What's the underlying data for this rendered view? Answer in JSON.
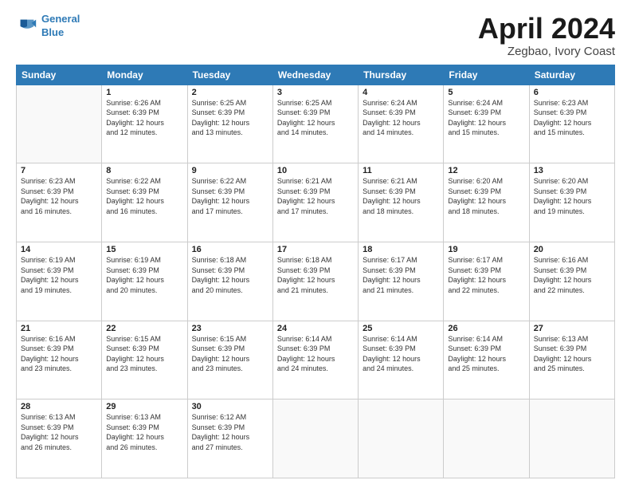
{
  "logo": {
    "line1": "General",
    "line2": "Blue"
  },
  "title": "April 2024",
  "subtitle": "Zegbao, Ivory Coast",
  "headers": [
    "Sunday",
    "Monday",
    "Tuesday",
    "Wednesday",
    "Thursday",
    "Friday",
    "Saturday"
  ],
  "weeks": [
    [
      {
        "day": "",
        "info": ""
      },
      {
        "day": "1",
        "info": "Sunrise: 6:26 AM\nSunset: 6:39 PM\nDaylight: 12 hours\nand 12 minutes."
      },
      {
        "day": "2",
        "info": "Sunrise: 6:25 AM\nSunset: 6:39 PM\nDaylight: 12 hours\nand 13 minutes."
      },
      {
        "day": "3",
        "info": "Sunrise: 6:25 AM\nSunset: 6:39 PM\nDaylight: 12 hours\nand 14 minutes."
      },
      {
        "day": "4",
        "info": "Sunrise: 6:24 AM\nSunset: 6:39 PM\nDaylight: 12 hours\nand 14 minutes."
      },
      {
        "day": "5",
        "info": "Sunrise: 6:24 AM\nSunset: 6:39 PM\nDaylight: 12 hours\nand 15 minutes."
      },
      {
        "day": "6",
        "info": "Sunrise: 6:23 AM\nSunset: 6:39 PM\nDaylight: 12 hours\nand 15 minutes."
      }
    ],
    [
      {
        "day": "7",
        "info": "Sunrise: 6:23 AM\nSunset: 6:39 PM\nDaylight: 12 hours\nand 16 minutes."
      },
      {
        "day": "8",
        "info": "Sunrise: 6:22 AM\nSunset: 6:39 PM\nDaylight: 12 hours\nand 16 minutes."
      },
      {
        "day": "9",
        "info": "Sunrise: 6:22 AM\nSunset: 6:39 PM\nDaylight: 12 hours\nand 17 minutes."
      },
      {
        "day": "10",
        "info": "Sunrise: 6:21 AM\nSunset: 6:39 PM\nDaylight: 12 hours\nand 17 minutes."
      },
      {
        "day": "11",
        "info": "Sunrise: 6:21 AM\nSunset: 6:39 PM\nDaylight: 12 hours\nand 18 minutes."
      },
      {
        "day": "12",
        "info": "Sunrise: 6:20 AM\nSunset: 6:39 PM\nDaylight: 12 hours\nand 18 minutes."
      },
      {
        "day": "13",
        "info": "Sunrise: 6:20 AM\nSunset: 6:39 PM\nDaylight: 12 hours\nand 19 minutes."
      }
    ],
    [
      {
        "day": "14",
        "info": "Sunrise: 6:19 AM\nSunset: 6:39 PM\nDaylight: 12 hours\nand 19 minutes."
      },
      {
        "day": "15",
        "info": "Sunrise: 6:19 AM\nSunset: 6:39 PM\nDaylight: 12 hours\nand 20 minutes."
      },
      {
        "day": "16",
        "info": "Sunrise: 6:18 AM\nSunset: 6:39 PM\nDaylight: 12 hours\nand 20 minutes."
      },
      {
        "day": "17",
        "info": "Sunrise: 6:18 AM\nSunset: 6:39 PM\nDaylight: 12 hours\nand 21 minutes."
      },
      {
        "day": "18",
        "info": "Sunrise: 6:17 AM\nSunset: 6:39 PM\nDaylight: 12 hours\nand 21 minutes."
      },
      {
        "day": "19",
        "info": "Sunrise: 6:17 AM\nSunset: 6:39 PM\nDaylight: 12 hours\nand 22 minutes."
      },
      {
        "day": "20",
        "info": "Sunrise: 6:16 AM\nSunset: 6:39 PM\nDaylight: 12 hours\nand 22 minutes."
      }
    ],
    [
      {
        "day": "21",
        "info": "Sunrise: 6:16 AM\nSunset: 6:39 PM\nDaylight: 12 hours\nand 23 minutes."
      },
      {
        "day": "22",
        "info": "Sunrise: 6:15 AM\nSunset: 6:39 PM\nDaylight: 12 hours\nand 23 minutes."
      },
      {
        "day": "23",
        "info": "Sunrise: 6:15 AM\nSunset: 6:39 PM\nDaylight: 12 hours\nand 23 minutes."
      },
      {
        "day": "24",
        "info": "Sunrise: 6:14 AM\nSunset: 6:39 PM\nDaylight: 12 hours\nand 24 minutes."
      },
      {
        "day": "25",
        "info": "Sunrise: 6:14 AM\nSunset: 6:39 PM\nDaylight: 12 hours\nand 24 minutes."
      },
      {
        "day": "26",
        "info": "Sunrise: 6:14 AM\nSunset: 6:39 PM\nDaylight: 12 hours\nand 25 minutes."
      },
      {
        "day": "27",
        "info": "Sunrise: 6:13 AM\nSunset: 6:39 PM\nDaylight: 12 hours\nand 25 minutes."
      }
    ],
    [
      {
        "day": "28",
        "info": "Sunrise: 6:13 AM\nSunset: 6:39 PM\nDaylight: 12 hours\nand 26 minutes."
      },
      {
        "day": "29",
        "info": "Sunrise: 6:13 AM\nSunset: 6:39 PM\nDaylight: 12 hours\nand 26 minutes."
      },
      {
        "day": "30",
        "info": "Sunrise: 6:12 AM\nSunset: 6:39 PM\nDaylight: 12 hours\nand 27 minutes."
      },
      {
        "day": "",
        "info": ""
      },
      {
        "day": "",
        "info": ""
      },
      {
        "day": "",
        "info": ""
      },
      {
        "day": "",
        "info": ""
      }
    ]
  ]
}
